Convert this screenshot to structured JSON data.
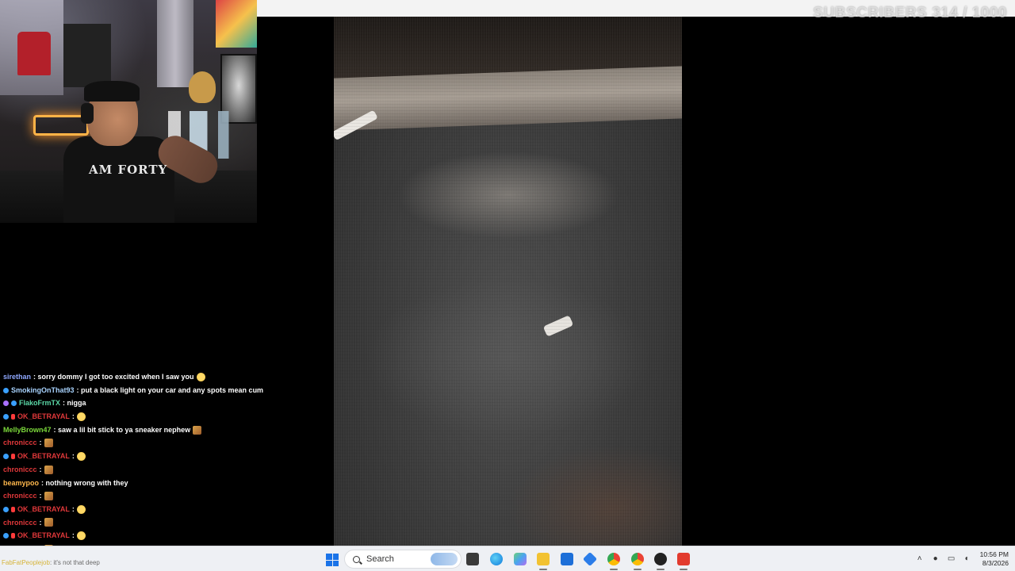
{
  "overlay": {
    "subscriber_goal_label": "SUBSCRIBERS",
    "subscriber_goal_count": "314 / 1000"
  },
  "webcam": {
    "shirt_text": "AM FORTY"
  },
  "chat": {
    "messages": [
      {
        "user": "sirethan",
        "user_color": "#8fa8ff",
        "badges": [],
        "text": ": sorry dommy I got too excited when I saw you",
        "emote": "face"
      },
      {
        "user": "SmokingOnThat93",
        "user_color": "#a9d4ff",
        "badges": [
          "blue"
        ],
        "text": ": put a black light on your car and any spots mean cum",
        "emote": ""
      },
      {
        "user": "FlakoFrmTX",
        "user_color": "#5bd9a8",
        "badges": [
          "purple",
          "blue"
        ],
        "text": ": nigga",
        "emote": ""
      },
      {
        "user": "OK_BETRAYAL",
        "user_color": "#e0383a",
        "badges": [
          "blue",
          "red"
        ],
        "text": ":",
        "emote": "face"
      },
      {
        "user": "MellyBrown47",
        "user_color": "#7cd93b",
        "badges": [],
        "text": ": saw a lil bit stick to ya sneaker nephew",
        "emote": "img"
      },
      {
        "user": "chroniccc",
        "user_color": "#e0383a",
        "badges": [],
        "text": ":",
        "emote": "img"
      },
      {
        "user": "OK_BETRAYAL",
        "user_color": "#e0383a",
        "badges": [
          "blue",
          "red"
        ],
        "text": ":",
        "emote": "face"
      },
      {
        "user": "chroniccc",
        "user_color": "#e0383a",
        "badges": [],
        "text": ":",
        "emote": "img"
      },
      {
        "user": "beamypoo",
        "user_color": "#ffb84d",
        "badges": [],
        "text": ": nothing wrong with they",
        "emote": ""
      },
      {
        "user": "chroniccc",
        "user_color": "#e0383a",
        "badges": [],
        "text": ":",
        "emote": "img"
      },
      {
        "user": "OK_BETRAYAL",
        "user_color": "#e0383a",
        "badges": [
          "blue",
          "red"
        ],
        "text": ":",
        "emote": "face"
      },
      {
        "user": "chroniccc",
        "user_color": "#e0383a",
        "badges": [],
        "text": ":",
        "emote": "img"
      },
      {
        "user": "OK_BETRAYAL",
        "user_color": "#e0383a",
        "badges": [
          "blue",
          "red"
        ],
        "text": ":",
        "emote": "face"
      },
      {
        "user": "chroniccc",
        "user_color": "#e0383a",
        "badges": [],
        "text": ":",
        "emote": "img"
      }
    ],
    "fading_message": {
      "user": "FabFatPeoplejob",
      "text": "it's not that deep"
    }
  },
  "taskbar": {
    "search_placeholder": "Search",
    "time": "10:56 PM",
    "date": "8/3/2026",
    "colors": {
      "start": "#1a73e8",
      "edge": "#0f7bdc",
      "explorer": "#f2c232",
      "store": "#1d6fd8",
      "chrome": "#34a853",
      "app_red": "#e23b2e"
    }
  }
}
